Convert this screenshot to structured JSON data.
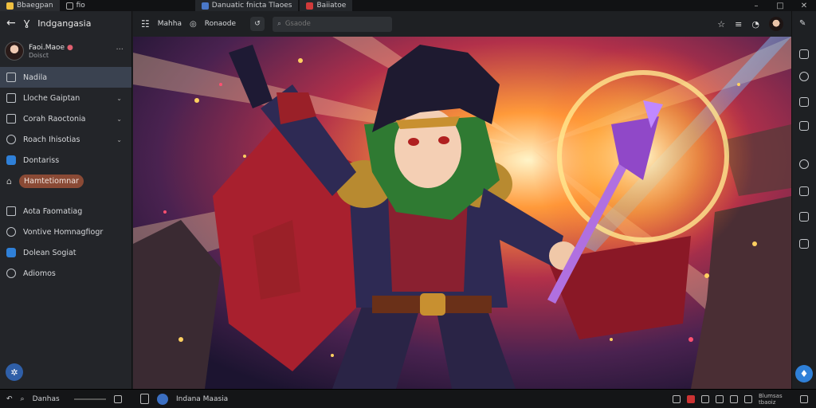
{
  "titlebar": {
    "tabs": [
      {
        "label": "Bbaegpan",
        "color": "#f0c040"
      },
      {
        "label": "fio",
        "color": ""
      },
      {
        "label": "Danuatic fnicta Tlaoes",
        "color": "#4a78c8"
      },
      {
        "label": "Baiiatoe",
        "color": "#d03a3a"
      }
    ]
  },
  "sidebar": {
    "title": "Indgangasia",
    "user": {
      "name": "Faoi.Maoe",
      "sub": "Doisct"
    },
    "items": [
      {
        "label": "Nadila"
      },
      {
        "label": "Lloche Gaiptan"
      },
      {
        "label": "Corah Raoctonia"
      },
      {
        "label": "Roach Ihisotias"
      },
      {
        "label": "Dontariss"
      },
      {
        "label": "Hamtetiomnar"
      },
      {
        "label": "Aota Faomatiag"
      },
      {
        "label": "Vontive Homnagfiogr"
      },
      {
        "label": "Dolean Sogiat"
      },
      {
        "label": "Adiomos"
      }
    ]
  },
  "toolbar": {
    "view_label": "Mahha",
    "status_label": "Ronaode",
    "search_placeholder": "Gsaode"
  },
  "statusbar": {
    "left_label": "Danhas",
    "doc_title": "Indana Maasia",
    "right_label": "Blumsas tbaoiz"
  },
  "colors": {
    "accent": "#2f80d8",
    "selected": "#3a4250",
    "pill": "#8a4a35"
  }
}
